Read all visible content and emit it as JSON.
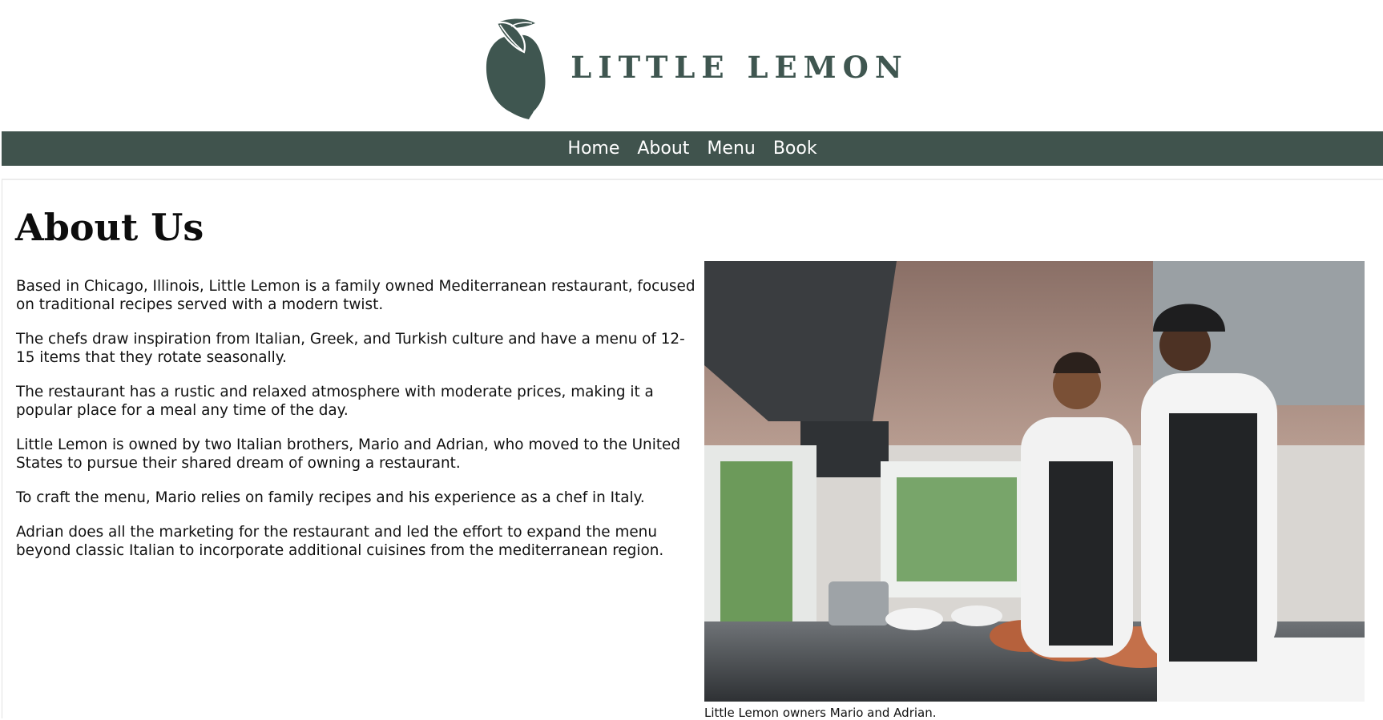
{
  "brand": {
    "name": "LITTLE LEMON",
    "color": "#3f5650"
  },
  "nav": {
    "background": "#40534d",
    "items": [
      {
        "label": "Home"
      },
      {
        "label": "About"
      },
      {
        "label": "Menu"
      },
      {
        "label": "Book"
      }
    ]
  },
  "main": {
    "title": "About Us",
    "paragraphs": [
      "Based in Chicago, Illinois, Little Lemon is a family owned Mediterranean restaurant, focused on traditional recipes served with a modern twist.",
      "The chefs draw inspiration from Italian, Greek, and Turkish culture and have a menu of 12-15 items that they rotate seasonally.",
      "The restaurant has a rustic and relaxed atmosphere with moderate prices, making it a popular place for a meal any time of the day.",
      "Little Lemon is owned by two Italian brothers, Mario and Adrian, who moved to the United States to pursue their shared dream of owning a restaurant.",
      "To craft the menu, Mario relies on family recipes and his experience as a chef in Italy.",
      "Adrian does all the marketing for the restaurant and led the effort to expand the menu beyond classic Italian to incorporate additional cuisines from the mediterranean region."
    ],
    "image_caption": "Little Lemon owners Mario and Adrian."
  }
}
